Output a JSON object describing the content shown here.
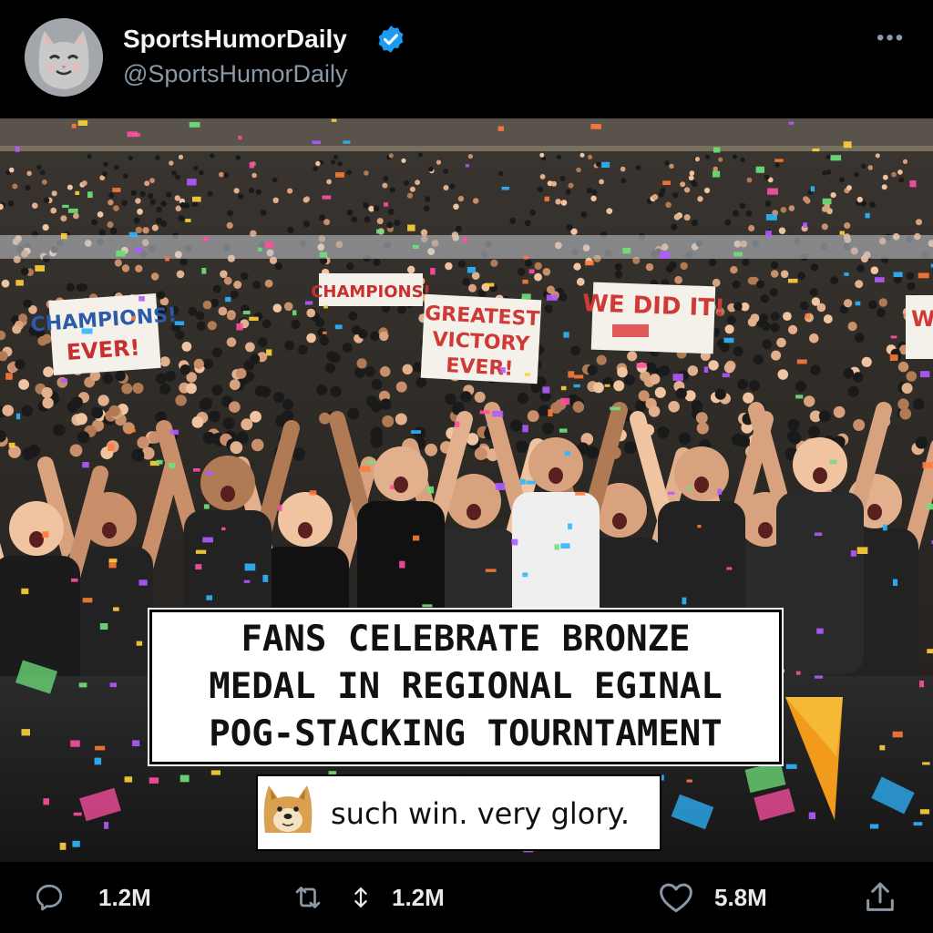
{
  "post": {
    "display_name": "SportsHumorDaily",
    "handle": "@SportsHumorDaily",
    "verified": true,
    "more_icon": "ellipsis-icon"
  },
  "media": {
    "signs": [
      "CHAMPIONS!",
      "CHAMPIONS!\nEVER!",
      "GREATEST\nVICTORY\nEVER!",
      "WE DID IT!",
      "W"
    ],
    "caption_lines": [
      "FANS CELEBRATE BRONZE",
      "MEDAL IN REGIONAL EGINAL",
      "POG-STACKING TOURNTAMENT"
    ],
    "doge_text": "such win. very glory."
  },
  "actions": {
    "reply_count": "1.2M",
    "retweet_count": "1.2M",
    "like_count": "5.8M"
  },
  "colors": {
    "verified_blue": "#1d9bf0",
    "muted_gray": "#8b98a5",
    "background": "#000000"
  }
}
